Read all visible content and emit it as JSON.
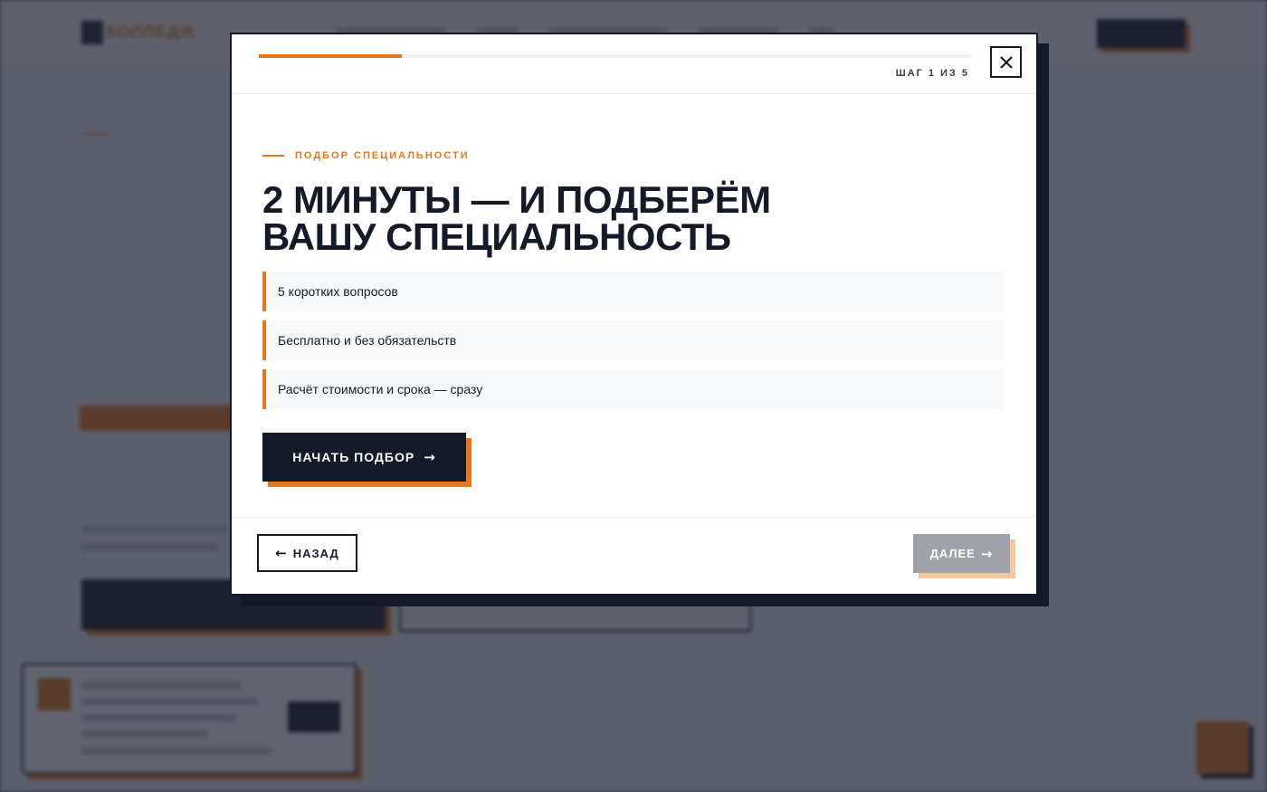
{
  "modal": {
    "step_label": "ШАГ 1 ИЗ 5",
    "progress_fraction": 0.2,
    "eyebrow": "ПОДБОР СПЕЦИАЛЬНОСТИ",
    "title_lines": [
      "2 МИНУТЫ — И ПОДБЕРЁМ",
      "ВАШУ СПЕЦИАЛЬНОСТЬ"
    ],
    "features": [
      "5 коротких вопросов",
      "Бесплатно и без обязательств",
      "Расчёт стоимости и срока — сразу"
    ],
    "start_button": "НАЧАТЬ ПОДБОР",
    "back_button": "НАЗАД",
    "next_button": "ДАЛЕЕ",
    "close_icon": "close-icon",
    "arrow_right_icon": "→",
    "arrow_left_icon": "←"
  },
  "colors": {
    "accent": "#e47820",
    "dark": "#151a28",
    "disabled": "#9fa2a8"
  }
}
